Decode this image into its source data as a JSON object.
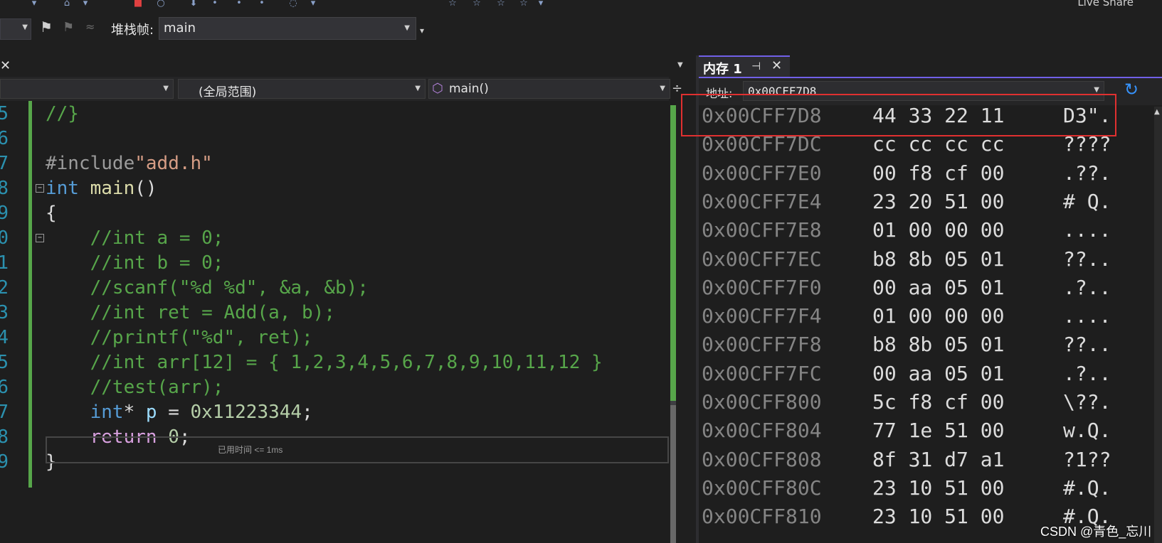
{
  "toolbar": {
    "live_share": "Live Share"
  },
  "debug_location": {
    "stack_label": "堆栈帧:",
    "stack_value": "main"
  },
  "editor": {
    "nav": {
      "scope": "(全局范围)",
      "function": "main()"
    },
    "elapsed_hint": "已用时间 <= 1ms",
    "lines": [
      {
        "n": "5",
        "tokens": [
          {
            "t": "//}",
            "c": "cm"
          }
        ]
      },
      {
        "n": "6",
        "tokens": []
      },
      {
        "n": "7",
        "tokens": [
          {
            "t": "#include",
            "c": "pp"
          },
          {
            "t": "\"add.h\"",
            "c": "str"
          }
        ]
      },
      {
        "n": "8",
        "tokens": [
          {
            "t": "int",
            "c": "kw"
          },
          {
            "t": " ",
            "c": ""
          },
          {
            "t": "main",
            "c": "fn"
          },
          {
            "t": "()",
            "c": ""
          }
        ]
      },
      {
        "n": "9",
        "tokens": [
          {
            "t": "{",
            "c": ""
          }
        ]
      },
      {
        "n": "0",
        "tokens": [
          {
            "t": "    //int a = 0;",
            "c": "cm"
          }
        ]
      },
      {
        "n": "1",
        "tokens": [
          {
            "t": "    //int b = 0;",
            "c": "cm"
          }
        ]
      },
      {
        "n": "2",
        "tokens": [
          {
            "t": "    //scanf(\"%d %d\", &a, &b);",
            "c": "cm"
          }
        ]
      },
      {
        "n": "3",
        "tokens": [
          {
            "t": "    //int ret = Add(a, b);",
            "c": "cm"
          }
        ]
      },
      {
        "n": "4",
        "tokens": [
          {
            "t": "    //printf(\"%d\", ret);",
            "c": "cm"
          }
        ]
      },
      {
        "n": "5",
        "tokens": [
          {
            "t": "    //int arr[12] = { 1,2,3,4,5,6,7,8,9,10,11,12 }",
            "c": "cm"
          }
        ]
      },
      {
        "n": "6",
        "tokens": [
          {
            "t": "    //test(arr);",
            "c": "cm"
          }
        ]
      },
      {
        "n": "7",
        "tokens": [
          {
            "t": "    ",
            "c": ""
          },
          {
            "t": "int",
            "c": "kw"
          },
          {
            "t": "* ",
            "c": ""
          },
          {
            "t": "p",
            "c": "var"
          },
          {
            "t": " = ",
            "c": ""
          },
          {
            "t": "0x11223344",
            "c": "num"
          },
          {
            "t": ";",
            "c": ""
          }
        ]
      },
      {
        "n": "8",
        "tokens": [
          {
            "t": "    ",
            "c": ""
          },
          {
            "t": "return",
            "c": "ctl"
          },
          {
            "t": " ",
            "c": ""
          },
          {
            "t": "0",
            "c": "num"
          },
          {
            "t": ";",
            "c": ""
          }
        ]
      },
      {
        "n": "9",
        "tokens": [
          {
            "t": "}",
            "c": ""
          }
        ]
      }
    ]
  },
  "memory": {
    "tab_title": "内存 1",
    "address_label": "地址:",
    "address_value": "0x00CFF7D8",
    "rows": [
      {
        "addr": "0x00CFF7D8",
        "bytes": "44 33 22 11",
        "ascii": "D3\"."
      },
      {
        "addr": "0x00CFF7DC",
        "bytes": "cc cc cc cc",
        "ascii": "????"
      },
      {
        "addr": "0x00CFF7E0",
        "bytes": "00 f8 cf 00",
        "ascii": ".??."
      },
      {
        "addr": "0x00CFF7E4",
        "bytes": "23 20 51 00",
        "ascii": "# Q."
      },
      {
        "addr": "0x00CFF7E8",
        "bytes": "01 00 00 00",
        "ascii": "...."
      },
      {
        "addr": "0x00CFF7EC",
        "bytes": "b8 8b 05 01",
        "ascii": "??.."
      },
      {
        "addr": "0x00CFF7F0",
        "bytes": "00 aa 05 01",
        "ascii": ".?.."
      },
      {
        "addr": "0x00CFF7F4",
        "bytes": "01 00 00 00",
        "ascii": "...."
      },
      {
        "addr": "0x00CFF7F8",
        "bytes": "b8 8b 05 01",
        "ascii": "??.."
      },
      {
        "addr": "0x00CFF7FC",
        "bytes": "00 aa 05 01",
        "ascii": ".?.."
      },
      {
        "addr": "0x00CFF800",
        "bytes": "5c f8 cf 00",
        "ascii": "\\??."
      },
      {
        "addr": "0x00CFF804",
        "bytes": "77 1e 51 00",
        "ascii": "w.Q."
      },
      {
        "addr": "0x00CFF808",
        "bytes": "8f 31 d7 a1",
        "ascii": "?1??"
      },
      {
        "addr": "0x00CFF80C",
        "bytes": "23 10 51 00",
        "ascii": "#.Q."
      },
      {
        "addr": "0x00CFF810",
        "bytes": "23 10 51 00",
        "ascii": "#.Q."
      }
    ]
  },
  "watermark": "CSDN @青色_忘川",
  "colors": {
    "accent": "#7160e8",
    "highlight": "#e03030",
    "gutter_green": "#57a64a"
  }
}
